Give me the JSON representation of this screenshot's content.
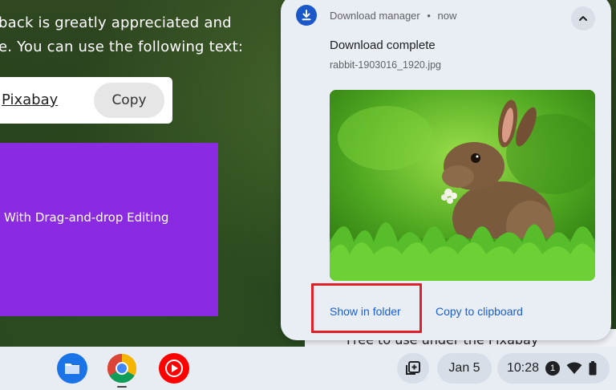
{
  "background_page": {
    "line1": "back is greatly appreciated and",
    "line2": "e. You can use the following text:",
    "credit_link": "Pixabay",
    "copy_button": "Copy",
    "promo_text": "With Drag-and-drop Editing",
    "underlying_text": "Free to use under the Pixabay"
  },
  "notification": {
    "app_name": "Download manager",
    "separator": "•",
    "time": "now",
    "title": "Download complete",
    "filename": "rabbit-1903016_1920.jpg",
    "preview_icon": "rabbit-image",
    "collapse_icon": "chevron-up-icon",
    "app_icon": "download-icon",
    "actions": {
      "show_in_folder": "Show in folder",
      "copy_to_clipboard": "Copy to clipboard"
    },
    "highlight_color": "#e0202a"
  },
  "shelf": {
    "apps": [
      {
        "name": "Files",
        "icon": "files-icon"
      },
      {
        "name": "Chrome",
        "icon": "chrome-icon"
      },
      {
        "name": "YouTube Music",
        "icon": "youtube-music-icon"
      }
    ],
    "screenshot_icon": "screen-capture-icon",
    "date": "Jan 5",
    "time": "10:28",
    "notification_count": "1",
    "status_icons": [
      "wifi-icon",
      "battery-icon"
    ]
  },
  "colors": {
    "accent_blue": "#1a5fd0",
    "purple_block": "#8a2be2"
  }
}
